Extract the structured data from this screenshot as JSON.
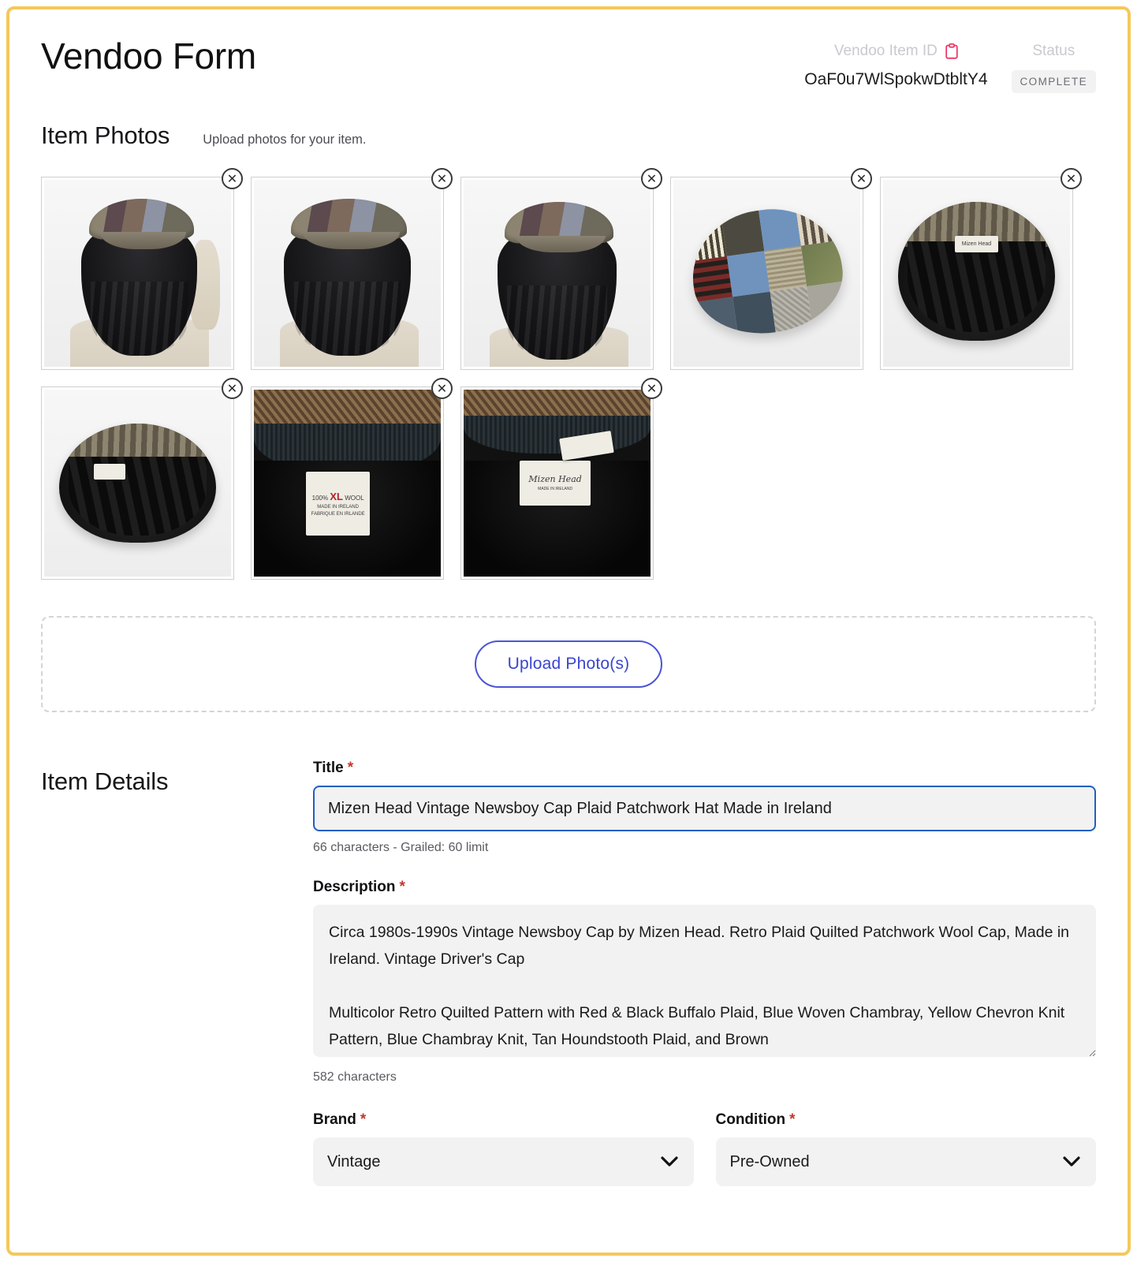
{
  "header": {
    "title": "Vendoo Form",
    "item_id_label": "Vendoo Item ID",
    "item_id_value": "OaF0u7WlSpokwDtbltY4",
    "copy_icon": "clipboard-icon",
    "copy_icon_color": "#ec3a68",
    "status_label": "Status",
    "status_value": "COMPLETE"
  },
  "photos": {
    "section_title": "Item Photos",
    "section_subtitle": "Upload photos for your item.",
    "delete_icon": "close-circle-icon",
    "items": [
      {
        "alt": "Model wearing patchwork newsboy cap, back view with hand on brim",
        "type": "model"
      },
      {
        "alt": "Model wearing patchwork newsboy cap, back view",
        "type": "model"
      },
      {
        "alt": "Model wearing patchwork newsboy cap, rear close view",
        "type": "model"
      },
      {
        "alt": "Patchwork wool newsboy cap laid flat, top view",
        "type": "flatcap"
      },
      {
        "alt": "Newsboy cap interior with black lining and brand tag",
        "type": "lining"
      },
      {
        "alt": "Newsboy cap interior top view with tag",
        "type": "lining"
      },
      {
        "alt": "Close-up of 100% wool XL care tag, Made in Ireland",
        "type": "closeup-care"
      },
      {
        "alt": "Close-up of Mizen Head brand label, Made in Ireland",
        "type": "closeup-brand"
      }
    ],
    "upload_button": "Upload Photo(s)"
  },
  "details": {
    "section_title": "Item Details",
    "title_field": {
      "label": "Title",
      "required_marker": "*",
      "value": "Mizen Head Vintage Newsboy Cap Plaid Patchwork Hat Made in Ireland",
      "helper": "66 characters - Grailed: 60 limit"
    },
    "description_field": {
      "label": "Description",
      "required_marker": "*",
      "value": "Circa 1980s-1990s Vintage Newsboy Cap by Mizen Head. Retro Plaid Quilted Patchwork Wool Cap, Made in Ireland. Vintage Driver's Cap\n\nMulticolor Retro Quilted Pattern with Red & Black Buffalo Plaid, Blue Woven Chambray, Yellow Chevron Knit Pattern, Blue Chambray Knit, Tan Houndstooth Plaid, and Brown",
      "helper": "582 characters"
    },
    "brand_field": {
      "label": "Brand",
      "required_marker": "*",
      "value": "Vintage"
    },
    "condition_field": {
      "label": "Condition",
      "required_marker": "*",
      "value": "Pre-Owned"
    },
    "chevron_icon": "chevron-down-icon"
  },
  "theme": {
    "page_border": "#f5c85c",
    "accent_blue": "#3a45cf",
    "focus_blue": "#1f5fc4",
    "field_bg": "#f2f2f2",
    "required_red": "#c0392b"
  }
}
